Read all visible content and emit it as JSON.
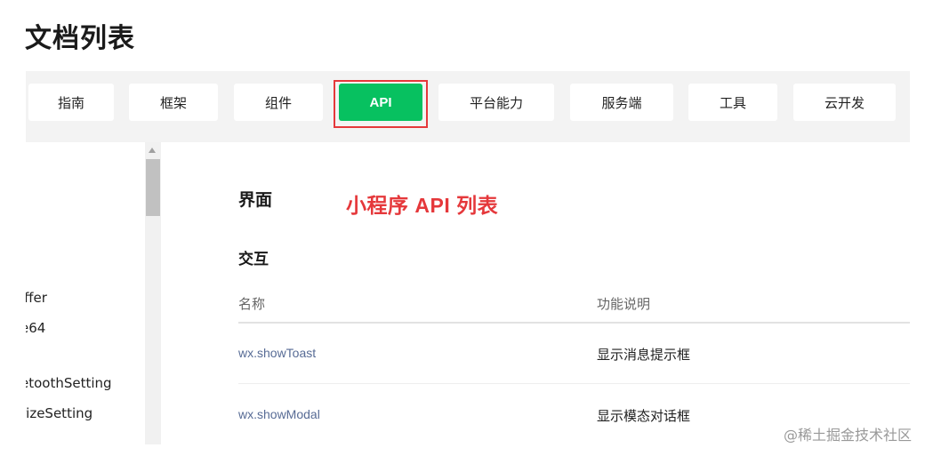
{
  "page": {
    "title": "文档列表"
  },
  "tabs": [
    {
      "label": "指南",
      "active": false
    },
    {
      "label": "框架",
      "active": false
    },
    {
      "label": "组件",
      "active": false
    },
    {
      "label": "API",
      "active": true
    },
    {
      "label": "平台能力",
      "active": false
    },
    {
      "label": "服务端",
      "active": false
    },
    {
      "label": "工具",
      "active": false
    },
    {
      "label": "云开发",
      "active": false
    }
  ],
  "sidebar": {
    "items": [
      {
        "label": "iffer"
      },
      {
        "label": "e64"
      },
      {
        "label": "etoothSetting"
      },
      {
        "label": "rizeSetting"
      }
    ]
  },
  "main": {
    "section_title": "界面",
    "annotation": "小程序 API 列表",
    "subsection_title": "交互",
    "table": {
      "headers": [
        "名称",
        "功能说明"
      ],
      "rows": [
        {
          "name": "wx.showToast",
          "desc": "显示消息提示框"
        },
        {
          "name": "wx.showModal",
          "desc": "显示模态对话框"
        }
      ]
    }
  },
  "watermark": "@稀土掘金技术社区",
  "colors": {
    "accent": "#07c160",
    "highlight_border": "#e5383b",
    "annotation": "#e5383b",
    "link": "#576b95",
    "tabbar_bg": "#f3f3f3"
  },
  "icons": {
    "scroll_up": "scroll-up-arrow-icon"
  }
}
